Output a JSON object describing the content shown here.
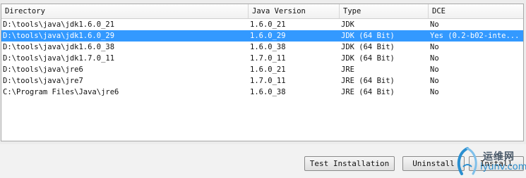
{
  "table": {
    "headers": [
      "Directory",
      "Java Version",
      "Type",
      "DCE"
    ],
    "rows": [
      {
        "directory": "D:\\tools\\java\\jdk1.6.0_21",
        "version": "1.6.0_21",
        "type": "JDK",
        "dce": "No"
      },
      {
        "directory": "D:\\tools\\java\\jdk1.6.0_29",
        "version": "1.6.0_29",
        "type": "JDK (64 Bit)",
        "dce": "Yes (0.2-b02-inte..."
      },
      {
        "directory": "D:\\tools\\java\\jdk1.6.0_38",
        "version": "1.6.0_38",
        "type": "JDK (64 Bit)",
        "dce": "No"
      },
      {
        "directory": "D:\\tools\\java\\jdk1.7.0_11",
        "version": "1.7.0_11",
        "type": "JDK (64 Bit)",
        "dce": "No"
      },
      {
        "directory": "D:\\tools\\java\\jre6",
        "version": "1.6.0_21",
        "type": "JRE",
        "dce": "No"
      },
      {
        "directory": "D:\\tools\\java\\jre7",
        "version": "1.7.0_11",
        "type": "JRE (64 Bit)",
        "dce": "No"
      },
      {
        "directory": "C:\\Program Files\\Java\\jre6",
        "version": "1.6.0_38",
        "type": "JRE (64 Bit)",
        "dce": "No"
      }
    ],
    "selected_index": 1,
    "selection_color": "#3399ff"
  },
  "buttons": {
    "test_installation": "Test Installation",
    "uninstall": "Uninstall",
    "install": "Install"
  },
  "watermark": {
    "text_cn": "运维网",
    "text_url": "iyunv.com"
  }
}
